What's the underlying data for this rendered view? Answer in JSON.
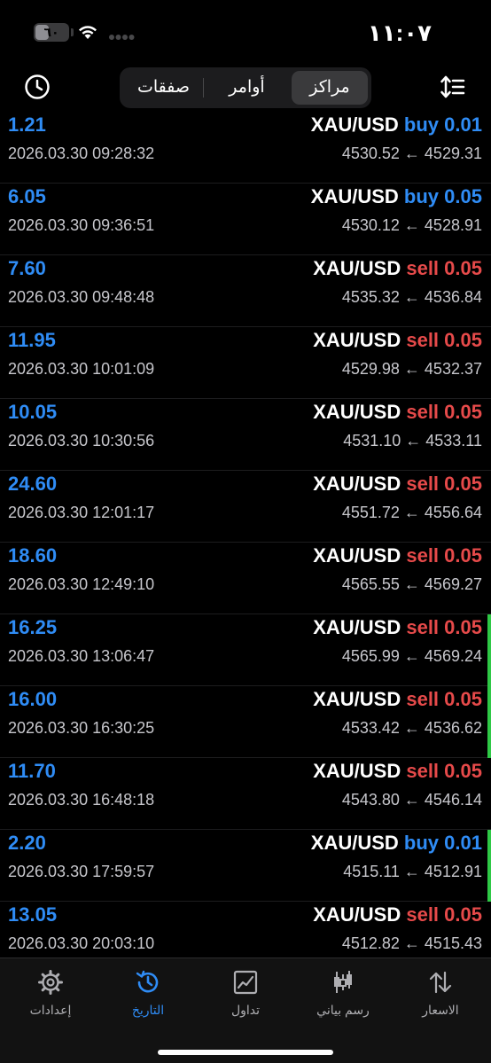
{
  "status_bar": {
    "time": "١١:٠٧",
    "battery": "٦٠"
  },
  "header": {
    "history_icon": "clock-history-icon",
    "sort_icon": "sort-icon",
    "segments": [
      "مراكز",
      "أوامر",
      "صفقات"
    ],
    "selected_segment": "مراكز"
  },
  "colors": {
    "accent": "#2f8cf5",
    "sell": "#e64a4a",
    "green_bar": "#2ec845",
    "secondary_text": "#c7c7cc"
  },
  "trades": [
    {
      "profit": "1.21",
      "time": "2026.03.30 09:28:32",
      "symbol": "XAU/USD",
      "side": "buy",
      "volume": "0.01",
      "open_price": "4529.31",
      "close_price": "4530.52",
      "indicator": false
    },
    {
      "profit": "6.05",
      "time": "2026.03.30 09:36:51",
      "symbol": "XAU/USD",
      "side": "buy",
      "volume": "0.05",
      "open_price": "4528.91",
      "close_price": "4530.12",
      "indicator": false
    },
    {
      "profit": "7.60",
      "time": "2026.03.30 09:48:48",
      "symbol": "XAU/USD",
      "side": "sell",
      "volume": "0.05",
      "open_price": "4536.84",
      "close_price": "4535.32",
      "indicator": false
    },
    {
      "profit": "11.95",
      "time": "2026.03.30 10:01:09",
      "symbol": "XAU/USD",
      "side": "sell",
      "volume": "0.05",
      "open_price": "4532.37",
      "close_price": "4529.98",
      "indicator": false
    },
    {
      "profit": "10.05",
      "time": "2026.03.30 10:30:56",
      "symbol": "XAU/USD",
      "side": "sell",
      "volume": "0.05",
      "open_price": "4533.11",
      "close_price": "4531.10",
      "indicator": false
    },
    {
      "profit": "24.60",
      "time": "2026.03.30 12:01:17",
      "symbol": "XAU/USD",
      "side": "sell",
      "volume": "0.05",
      "open_price": "4556.64",
      "close_price": "4551.72",
      "indicator": false
    },
    {
      "profit": "18.60",
      "time": "2026.03.30 12:49:10",
      "symbol": "XAU/USD",
      "side": "sell",
      "volume": "0.05",
      "open_price": "4569.27",
      "close_price": "4565.55",
      "indicator": false
    },
    {
      "profit": "16.25",
      "time": "2026.03.30 13:06:47",
      "symbol": "XAU/USD",
      "side": "sell",
      "volume": "0.05",
      "open_price": "4569.24",
      "close_price": "4565.99",
      "indicator": true
    },
    {
      "profit": "16.00",
      "time": "2026.03.30 16:30:25",
      "symbol": "XAU/USD",
      "side": "sell",
      "volume": "0.05",
      "open_price": "4536.62",
      "close_price": "4533.42",
      "indicator": true
    },
    {
      "profit": "11.70",
      "time": "2026.03.30 16:48:18",
      "symbol": "XAU/USD",
      "side": "sell",
      "volume": "0.05",
      "open_price": "4546.14",
      "close_price": "4543.80",
      "indicator": false
    },
    {
      "profit": "2.20",
      "time": "2026.03.30 17:59:57",
      "symbol": "XAU/USD",
      "side": "buy",
      "volume": "0.01",
      "open_price": "4512.91",
      "close_price": "4515.11",
      "indicator": true
    },
    {
      "profit": "13.05",
      "time": "2026.03.30 20:03:10",
      "symbol": "XAU/USD",
      "side": "sell",
      "volume": "0.05",
      "open_price": "4515.43",
      "close_price": "4512.82",
      "indicator": false
    }
  ],
  "tabbar": {
    "tabs": [
      {
        "label": "الاسعار",
        "icon": "quotes-arrows-icon"
      },
      {
        "label": "رسم بياني",
        "icon": "candlestick-chart-icon"
      },
      {
        "label": "تداول",
        "icon": "trade-chart-icon"
      },
      {
        "label": "التاريخ",
        "icon": "history-icon"
      },
      {
        "label": "إعدادات",
        "icon": "gear-icon"
      }
    ],
    "active": "التاريخ"
  }
}
